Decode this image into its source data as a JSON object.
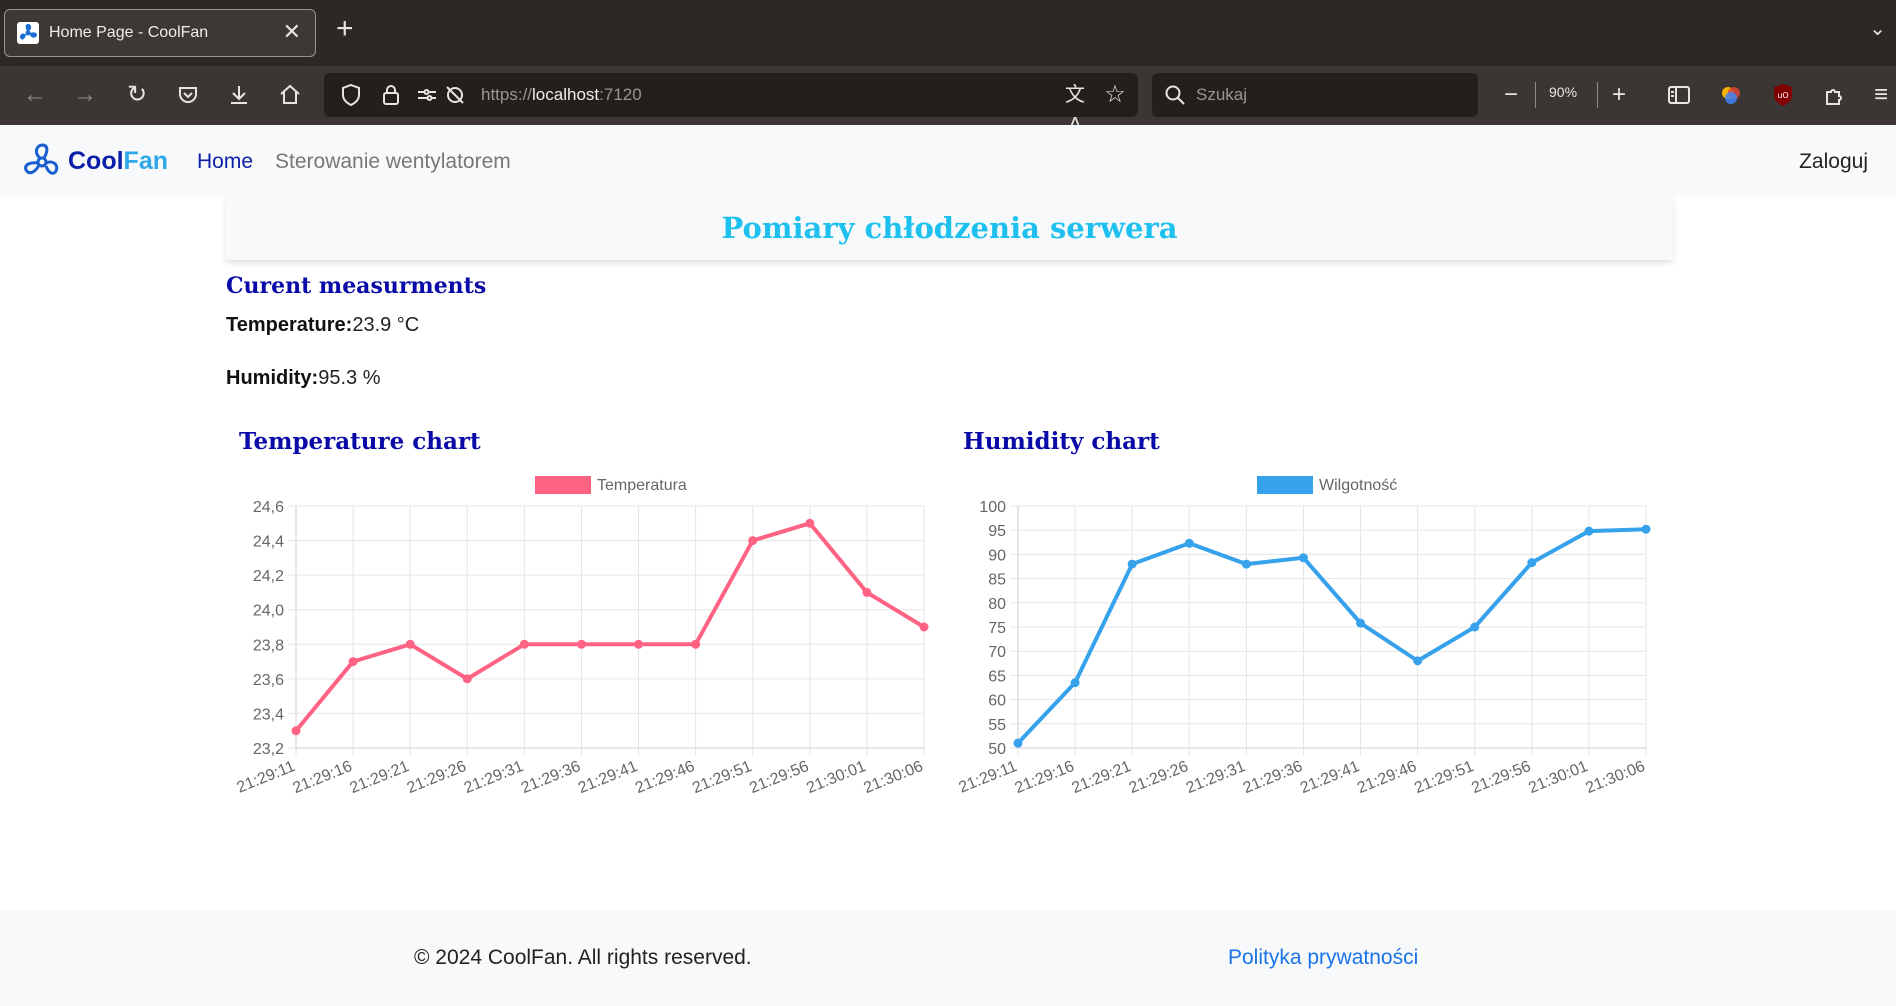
{
  "browser": {
    "tab_title": "Home Page - CoolFan",
    "url_prefix": "https://",
    "url_host": "localhost",
    "url_port": ":7120",
    "search_placeholder": "Szukaj",
    "zoom": "90%"
  },
  "header": {
    "brand_cool": "Cool",
    "brand_fan": "Fan",
    "nav": {
      "home": "Home",
      "fan_control": "Sterowanie wentylatorem",
      "login": "Zaloguj"
    }
  },
  "page": {
    "title": "Pomiary chłodzenia serwera",
    "current_heading": "Curent measurments",
    "temperature_label": "Temperature:",
    "temperature_value": "23.9 °C",
    "humidity_label": "Humidity:",
    "humidity_value": "95.3 %"
  },
  "charts": {
    "temp_heading": "Temperature chart",
    "hum_heading": "Humidity chart"
  },
  "chart_data": [
    {
      "type": "line",
      "title": "",
      "x": [
        "21:29:11",
        "21:29:16",
        "21:29:21",
        "21:29:26",
        "21:29:31",
        "21:29:36",
        "21:29:41",
        "21:29:46",
        "21:29:51",
        "21:29:56",
        "21:30:01",
        "21:30:06"
      ],
      "series": [
        {
          "name": "Temperatura",
          "values": [
            23.3,
            23.7,
            23.8,
            23.6,
            23.8,
            23.8,
            23.8,
            23.8,
            24.4,
            24.5,
            24.1,
            23.9
          ],
          "color": "#ff6384"
        }
      ],
      "ylim": [
        23.2,
        24.6
      ],
      "yticks": [
        "24,6",
        "24,4",
        "24,2",
        "24,0",
        "23,8",
        "23,6",
        "23,4",
        "23,2"
      ],
      "grid": true,
      "legend": "top"
    },
    {
      "type": "line",
      "title": "",
      "x": [
        "21:29:11",
        "21:29:16",
        "21:29:21",
        "21:29:26",
        "21:29:31",
        "21:29:36",
        "21:29:41",
        "21:29:46",
        "21:29:51",
        "21:29:56",
        "21:30:01",
        "21:30:06"
      ],
      "series": [
        {
          "name": "Wilgotność",
          "values": [
            51,
            63.5,
            88,
            92.3,
            88,
            89.3,
            75.8,
            68,
            75,
            88.3,
            94.8,
            95.2
          ],
          "color": "#36a2eb"
        }
      ],
      "ylim": [
        50,
        100
      ],
      "yticks": [
        "100",
        "95",
        "90",
        "85",
        "80",
        "75",
        "70",
        "65",
        "60",
        "55",
        "50"
      ],
      "grid": true,
      "legend": "top"
    }
  ],
  "footer": {
    "copyright": "© 2024 CoolFan. All rights reserved.",
    "privacy": "Polityka prywatności"
  }
}
